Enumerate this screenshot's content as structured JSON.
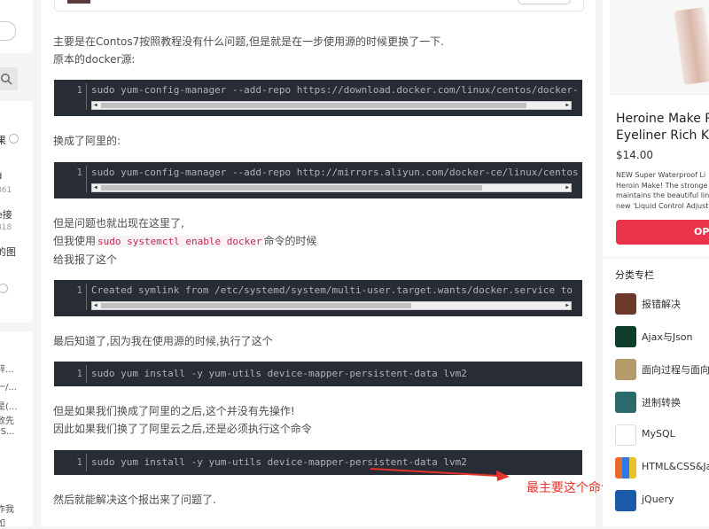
{
  "left_sidebar": {
    "fragments": [
      "果",
      "d",
      "861",
      "e接",
      "818",
      "的图"
    ],
    "comment_fragments": [
      "醉...",
      "一/...",
      "是(...",
      "致先",
      "\"S...",
      "作我",
      "如"
    ]
  },
  "article": {
    "para1": "主要是在Contos7按照教程没有什么问题,但是就是在一步使用源的时候更换了一下.",
    "para2": "原本的docker源:",
    "code1": "sudo yum-config-manager --add-repo https://download.docker.com/linux/centos/docker-",
    "para3": "换成了阿里的:",
    "code2": "sudo yum-config-manager --add-repo http://mirrors.aliyun.com/docker-ce/linux/centos",
    "para4": "但是问题也就出现在这里了,",
    "para5_pre": "但我使用",
    "para5_code": "sudo systemctl enable docker",
    "para5_post": "命令的时候",
    "para6": "给我报了这个",
    "code3": "Created symlink from /etc/systemd/system/multi-user.target.wants/docker.service to",
    "para7": "最后知道了,因为我在使用源的时候,执行了这个",
    "code4": "sudo yum install -y yum-utils device-mapper-persistent-data lvm2",
    "para8": "但是如果我们换成了阿里的之后,这个并没有先操作!",
    "para9": "因此如果我们换了了阿里云之后,还是必须执行这个命令",
    "code5": "sudo yum install -y yum-utils device-mapper-persistent-data lvm2",
    "para10": "然后就能解决这个报出来了问题了.",
    "line_no": "1",
    "annotation": "最主要这个命令"
  },
  "ad": {
    "title_line1": "Heroine Make P",
    "title_line2": "Eyeliner Rich Ke",
    "price": "$14.00",
    "desc": [
      "NEW Super Waterproof Li",
      "Heroin Make! The stronge",
      "maintains the beautiful lin",
      "new 'Liquid Control Adjust"
    ],
    "button": "OP"
  },
  "categories": {
    "heading": "分类专栏",
    "items": [
      {
        "label": "报错解决",
        "color": "#6b3a2a"
      },
      {
        "label": "Ajax与Json",
        "color": "#0f3d2a"
      },
      {
        "label": "面向过程与面向",
        "color": "#b59a6a"
      },
      {
        "label": "进制转换",
        "color": "#2a6a6a"
      },
      {
        "label": "MySQL",
        "color": "#ffffff"
      },
      {
        "label": "HTML&CSS&Ja",
        "color": "#e86a2a"
      },
      {
        "label": "jQuery",
        "color": "#1a5aa8"
      }
    ]
  },
  "colors": {
    "code_bg": "#282c34",
    "accent": "#e8334a",
    "annotation": "#e8332a"
  }
}
